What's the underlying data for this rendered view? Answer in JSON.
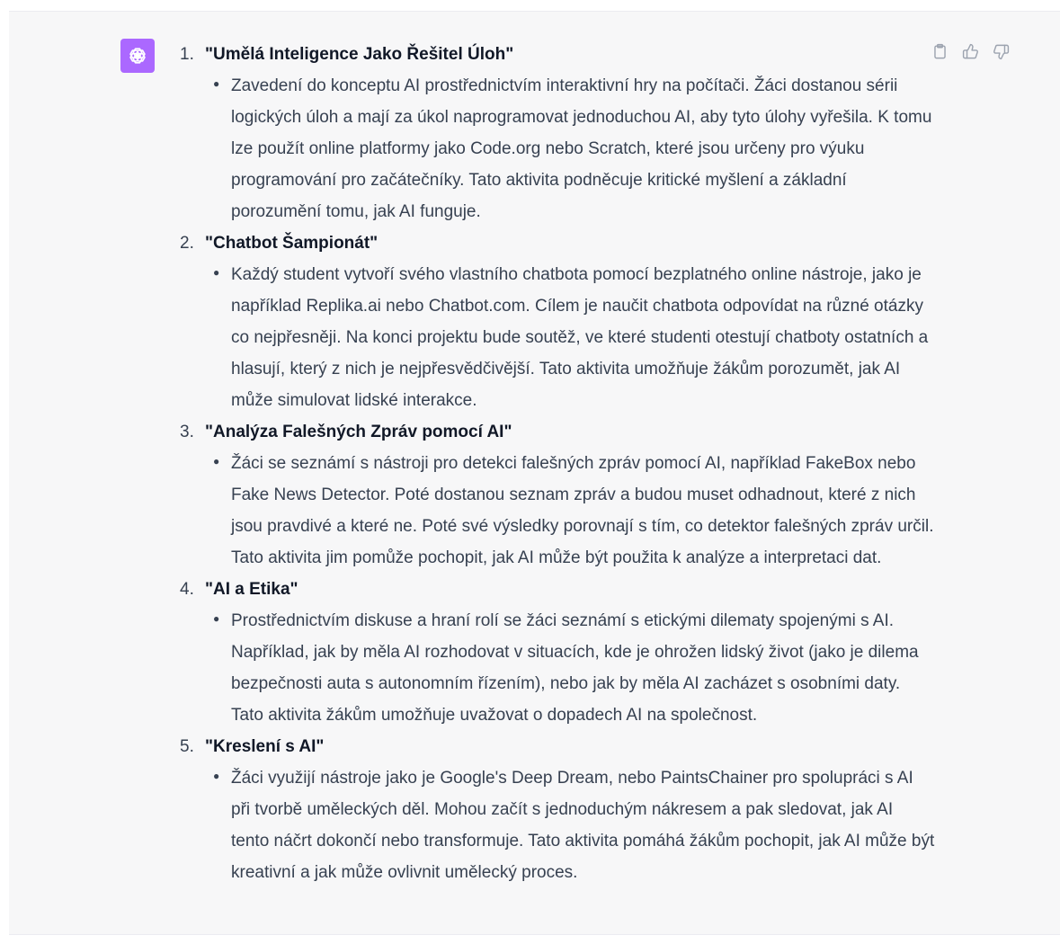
{
  "icons": {
    "avatar": "openai-logo-icon",
    "copy": "clipboard-icon",
    "like": "thumbs-up-icon",
    "dislike": "thumbs-down-icon"
  },
  "colors": {
    "avatar_bg": "#ab68ff",
    "message_bg": "#f7f7f8",
    "text": "#374151"
  },
  "items": [
    {
      "number": "1.",
      "title": "\"Umělá Inteligence Jako Řešitel Úloh\"",
      "bullet": "Zavedení do konceptu AI prostřednictvím interaktivní hry na počítači. Žáci dostanou sérii logických úloh a mají za úkol naprogramovat jednoduchou AI, aby tyto úlohy vyřešila. K tomu lze použít online platformy jako Code.org nebo Scratch, které jsou určeny pro výuku programování pro začátečníky. Tato aktivita podněcuje kritické myšlení a základní porozumění tomu, jak AI funguje."
    },
    {
      "number": "2.",
      "title": "\"Chatbot Šampionát\"",
      "bullet": "Každý student vytvoří svého vlastního chatbota pomocí bezplatného online nástroje, jako je například Replika.ai nebo Chatbot.com. Cílem je naučit chatbota odpovídat na různé otázky co nejpřesněji. Na konci projektu bude soutěž, ve které studenti otestují chatboty ostatních a hlasují, který z nich je nejpřesvědčivější. Tato aktivita umožňuje žákům porozumět, jak AI může simulovat lidské interakce."
    },
    {
      "number": "3.",
      "title": "\"Analýza Falešných Zpráv pomocí AI\"",
      "bullet": "Žáci se seznámí s nástroji pro detekci falešných zpráv pomocí AI, například FakeBox nebo Fake News Detector. Poté dostanou seznam zpráv a budou muset odhadnout, které z nich jsou pravdivé a které ne. Poté své výsledky porovnají s tím, co detektor falešných zpráv určil. Tato aktivita jim pomůže pochopit, jak AI může být použita k analýze a interpretaci dat."
    },
    {
      "number": "4.",
      "title": "\"AI a Etika\"",
      "bullet": "Prostřednictvím diskuse a hraní rolí se žáci seznámí s etickými dilematy spojenými s AI. Například, jak by měla AI rozhodovat v situacích, kde je ohrožen lidský život (jako je dilema bezpečnosti auta s autonomním řízením), nebo jak by měla AI zacházet s osobními daty. Tato aktivita žákům umožňuje uvažovat o dopadech AI na společnost."
    },
    {
      "number": "5.",
      "title": "\"Kreslení s AI\"",
      "bullet": "Žáci využijí nástroje jako je Google's Deep Dream, nebo PaintsChainer pro spolupráci s AI při tvorbě uměleckých děl. Mohou začít s jednoduchým nákresem a pak sledovat, jak AI tento náčrt dokončí nebo transformuje. Tato aktivita pomáhá žákům pochopit, jak AI může být kreativní a jak může ovlivnit umělecký proces."
    }
  ]
}
